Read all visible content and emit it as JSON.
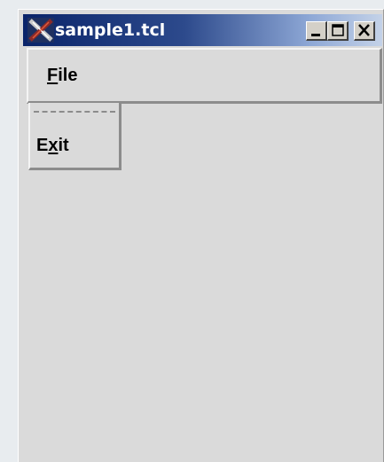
{
  "window": {
    "title": "sample1.tcl",
    "icon": "tk-feather-icon",
    "controls": {
      "minimize_icon": "minimize-icon",
      "maximize_icon": "maximize-icon",
      "close_icon": "close-icon"
    },
    "title_gradient": [
      "#0a246a",
      "#c4d2e8"
    ],
    "background": "#dadada"
  },
  "menubar": {
    "items": [
      {
        "mnemonic": "F",
        "rest": "ile"
      }
    ]
  },
  "dropdown": {
    "tearoff": true,
    "items": [
      {
        "before": "E",
        "mnemonic": "x",
        "after": "it"
      }
    ]
  }
}
